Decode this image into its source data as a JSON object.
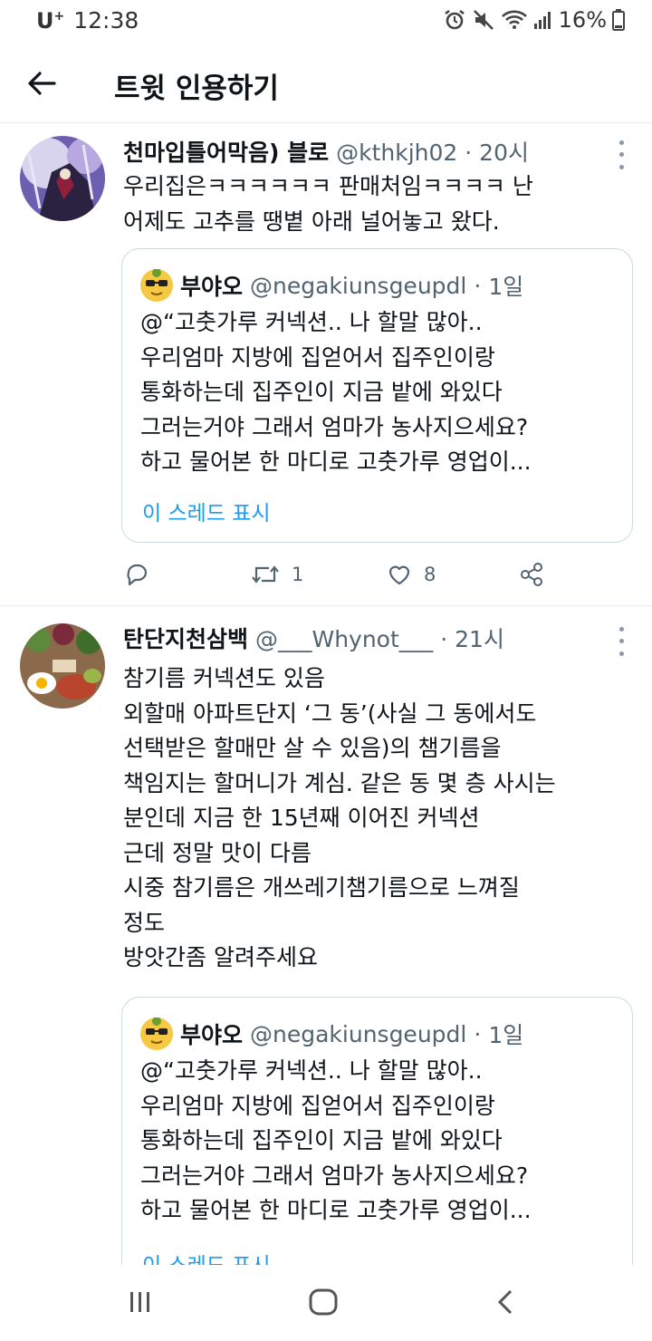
{
  "status": {
    "carrier": "U",
    "carrier_sup": "+",
    "time": "12:38",
    "battery": "16%"
  },
  "header": {
    "title": "트윗 인용하기"
  },
  "tweets": [
    {
      "display_name": "천마입틀어막음) 블로",
      "handle": "@kthkjh02",
      "time": "20시",
      "text_lines": [
        "우리집은ㅋㅋㅋㅋㅋㅋ 판매처임ㅋㅋㅋㅋ 난",
        "어제도 고추를 땡볕 아래 널어놓고 왔다."
      ],
      "quote": {
        "display_name": "부야오",
        "handle": "@negakiunsgeupdl",
        "time": "1일",
        "text_lines": [
          "@“고춧가루 커넥션.. 나 할말 많아..",
          "우리엄마 지방에 집얻어서 집주인이랑",
          "통화하는데 집주인이 지금 밭에 와있다",
          "그러는거야 그래서 엄마가 농사지으세요?",
          "하고 물어본 한 마디로 고춧가루 영업이..."
        ],
        "thread_link": "이 스레드 표시"
      },
      "retweets": "1",
      "likes": "8"
    },
    {
      "display_name": "탄단지천삼백",
      "handle": "@___Whynot___",
      "time": "21시",
      "text_lines": [
        "참기름 커넥션도 있음",
        "외할매 아파트단지 ‘그 동’(사실 그 동에서도",
        "선택받은 할매만 살 수 있음)의 챔기름을",
        "책임지는 할머니가 계심. 같은 동 몇 층 사시는",
        "분인데 지금 한 15년째 이어진 커넥션",
        "근데 정말 맛이 다름",
        "시중 참기름은 개쓰레기챔기름으로 느껴질",
        "정도",
        "방앗간좀 알려주세요"
      ],
      "quote": {
        "display_name": "부야오",
        "handle": "@negakiunsgeupdl",
        "time": "1일",
        "text_lines": [
          "@“고춧가루 커넥션.. 나 할말 많아..",
          "우리엄마 지방에 집얻어서 집주인이랑",
          "통화하는데 집주인이 지금 밭에 와있다",
          "그러는거야 그래서 엄마가 농사지으세요?",
          "하고 물어본 한 마디로 고춧가루 영업이..."
        ],
        "thread_link": "이 스레드 표시"
      }
    }
  ],
  "colors": {
    "text": "#0f1419",
    "muted": "#536471",
    "link": "#1d9bf0",
    "divider": "#e6ecf0",
    "quote_border": "#cfd9de"
  },
  "icons": [
    "back-arrow-icon",
    "more-icon",
    "reply-icon",
    "retweet-icon",
    "like-icon",
    "share-icon",
    "recent-apps-icon",
    "home-icon",
    "back-nav-icon"
  ]
}
